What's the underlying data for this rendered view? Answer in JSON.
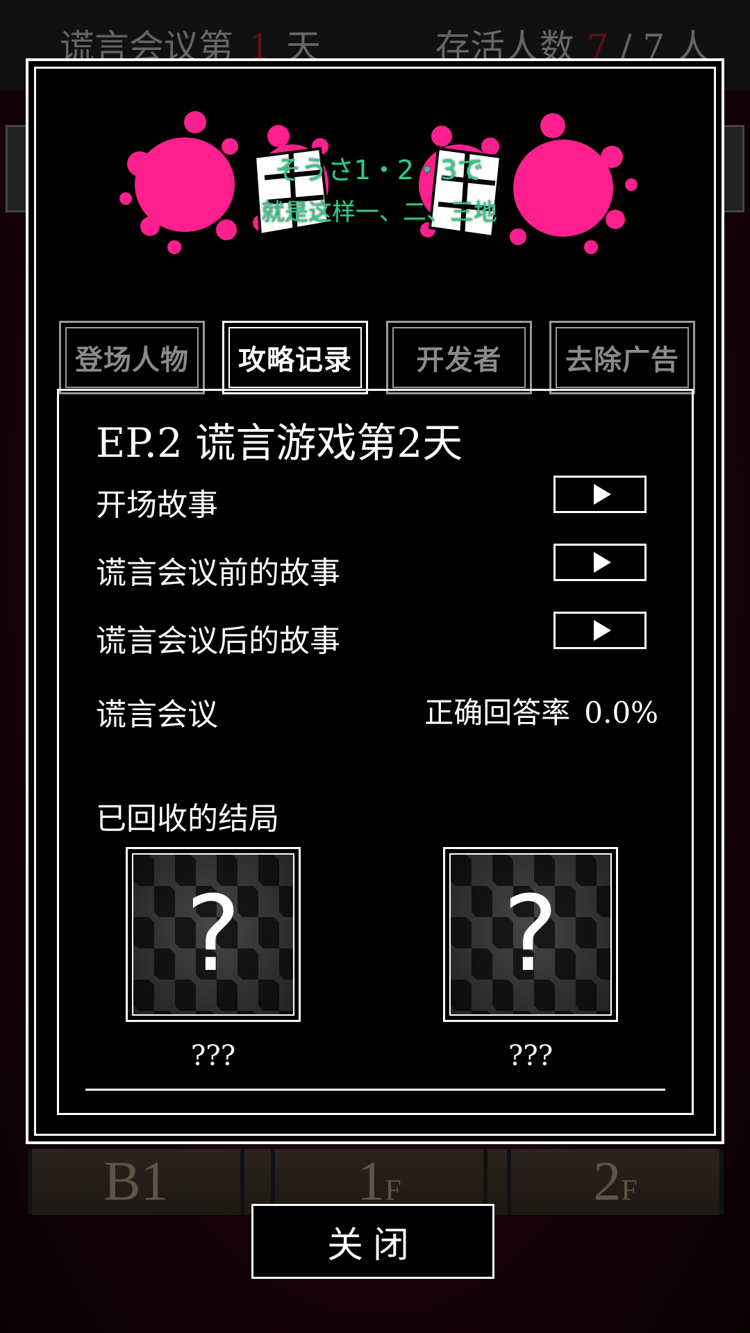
{
  "status_bar": {
    "day_prefix": "谎言会议第",
    "day_number": "1",
    "day_suffix": "天",
    "alive_label": "存活人数",
    "alive_count": "7",
    "alive_total": "/ 7 人"
  },
  "background_floors": [
    "B1",
    "1F",
    "2F"
  ],
  "logo": {
    "line_jp": "そうさ1・2・3で",
    "line_cn": "就是这样一、二、三地",
    "splat_color": "#ff1f8e",
    "text_color": "#33c889"
  },
  "tabs": [
    {
      "label": "登场人物",
      "active": false
    },
    {
      "label": "攻略记录",
      "active": true
    },
    {
      "label": "开发者",
      "active": false
    },
    {
      "label": "去除广告",
      "active": false
    }
  ],
  "episode": {
    "title": "EP.2  谎言游戏第2天",
    "stories": [
      {
        "label": "开场故事"
      },
      {
        "label": "谎言会议前的故事"
      },
      {
        "label": "谎言会议后的故事"
      }
    ],
    "meeting_label": "谎言会议",
    "correct_rate_label": "正确回答率",
    "correct_rate_value": "0.0%",
    "endings_title": "已回收的结局",
    "endings": [
      {
        "mark": "?",
        "name": "???"
      },
      {
        "mark": "?",
        "name": "???"
      }
    ]
  },
  "close_button": "关闭"
}
